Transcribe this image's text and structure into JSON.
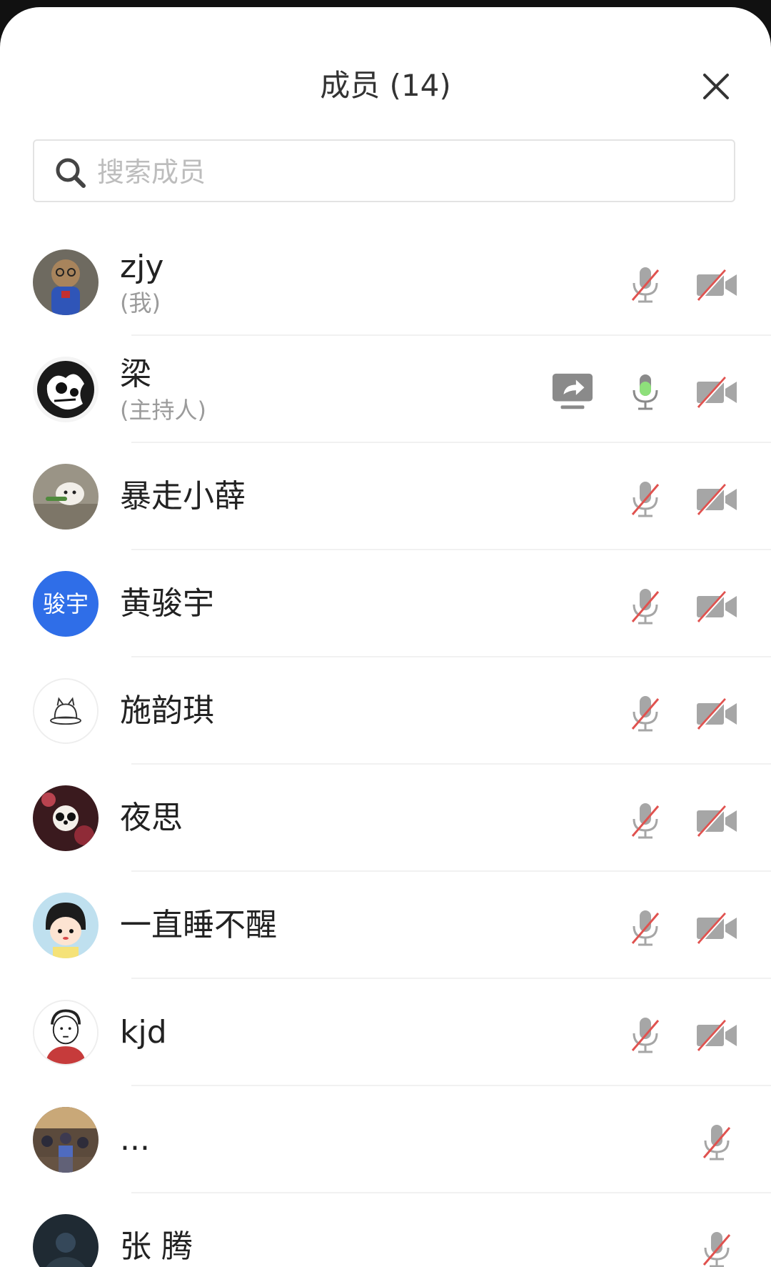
{
  "header": {
    "title": "成员 (14)"
  },
  "search": {
    "placeholder": "搜索成员",
    "value": ""
  },
  "members": [
    {
      "name": "zjy",
      "role": "(我)",
      "avatar": "photo-toy-bear",
      "mic": "muted",
      "camera": "off"
    },
    {
      "name": "梁",
      "role": "(主持人)",
      "avatar": "photo-bw-art",
      "screen_share": true,
      "mic": "active",
      "camera": "off"
    },
    {
      "name": "暴走小薛",
      "role": "",
      "avatar": "photo-cat",
      "mic": "muted",
      "camera": "off"
    },
    {
      "name": "黄骏宇",
      "role": "",
      "avatar_text": "骏宇",
      "avatar_color": "#2f6ee8",
      "mic": "muted",
      "camera": "off"
    },
    {
      "name": "施韵琪",
      "role": "",
      "avatar": "drawing-cat",
      "mic": "muted",
      "camera": "off"
    },
    {
      "name": "夜思",
      "role": "",
      "avatar": "photo-panda",
      "mic": "muted",
      "camera": "off"
    },
    {
      "name": "一直睡不醒",
      "role": "",
      "avatar": "cartoon-girl",
      "mic": "muted",
      "camera": "off"
    },
    {
      "name": "kjd",
      "role": "",
      "avatar": "cartoon-boy",
      "mic": "muted",
      "camera": "off"
    },
    {
      "name": "...",
      "role": "",
      "avatar": "photo-crowd",
      "mic": "muted"
    },
    {
      "name": "张 腾",
      "role": "",
      "avatar": "photo-dark",
      "mic": "muted"
    }
  ],
  "colors": {
    "muted_icon": "#a6a6a6",
    "muted_slash": "#e0524f",
    "active_mic": "#8ee07b",
    "share_icon": "#8a8a8a",
    "avatar_blue": "#2f6ee8"
  },
  "icons": {
    "close": "close-icon",
    "search": "search-icon",
    "mic_muted": "mic-muted-icon",
    "mic_active": "mic-active-icon",
    "camera_off": "camera-off-icon",
    "share_screen": "share-screen-icon"
  }
}
